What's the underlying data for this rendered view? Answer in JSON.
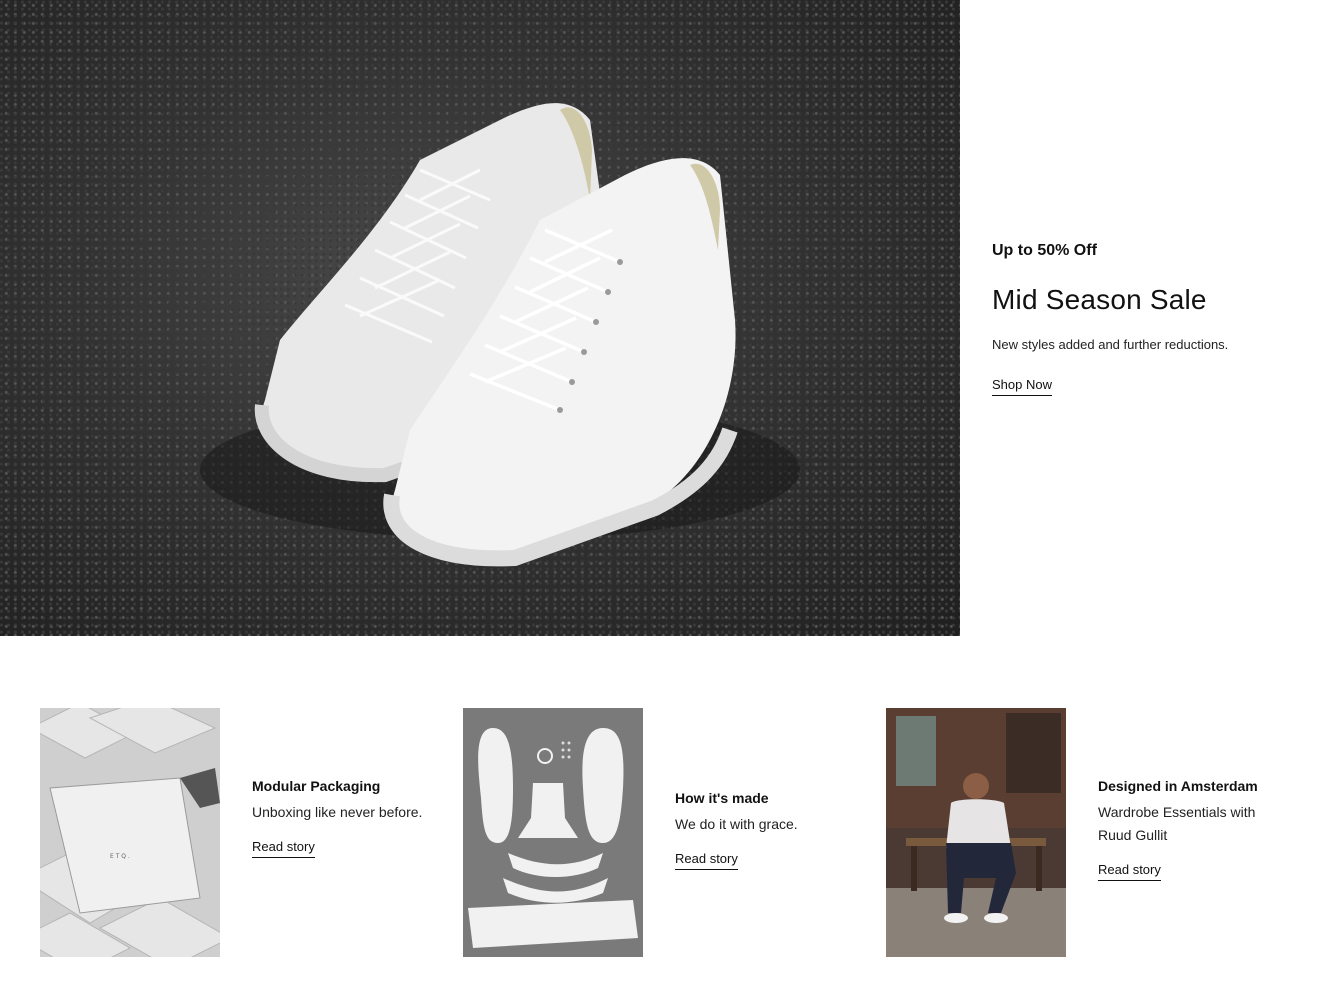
{
  "hero": {
    "eyebrow": "Up to 50% Off",
    "title": "Mid Season Sale",
    "subtitle": "New styles added and further reductions.",
    "cta": "Shop Now",
    "image_alt": "white leather sneakers on asphalt"
  },
  "stories": [
    {
      "title": "Modular Packaging",
      "description": "Unboxing like never before.",
      "link": "Read story",
      "image_alt": "stacked white shoe boxes"
    },
    {
      "title": "How it's made",
      "description": "We do it with grace.",
      "link": "Read story",
      "image_alt": "shoe parts laid out flat"
    },
    {
      "title": "Designed in Amsterdam",
      "description": "Wardrobe Essentials with Ruud Gullit",
      "link": "Read story",
      "image_alt": "man sitting on a bench"
    }
  ],
  "colors": {
    "text": "#111111",
    "background": "#ffffff",
    "asphalt": "#2e2e2e",
    "sneaker": "#f2f2f2",
    "heel_accent": "#cfc9a8"
  }
}
